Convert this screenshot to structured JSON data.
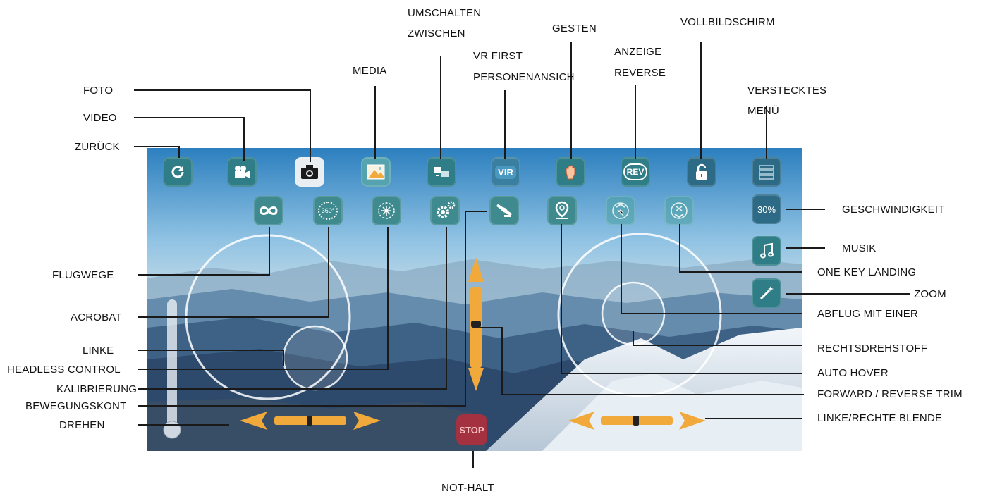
{
  "callouts": {
    "foto": "FOTO",
    "video": "VIDEO",
    "zurueck": "ZURÜCK",
    "media": "MEDIA",
    "umschalten_1": "UMSCHALTEN",
    "umschalten_2": "ZWISCHEN",
    "vr_1": "VR FIRST",
    "vr_2": "PERSONENANSICH",
    "gesten": "GESTEN",
    "anzeige_1": "ANZEIGE",
    "anzeige_2": "REVERSE",
    "vollbild": "VOLLBILDSCHIRM",
    "versteckt_1": "VERSTECKTES",
    "versteckt_2": "MENÜ",
    "geschwindigkeit": "GESCHWINDIGKEIT",
    "musik": "MUSIK",
    "one_key_landing": "ONE KEY LANDING",
    "zoom": "ZOOM",
    "abflug": "ABFLUG MIT EINER",
    "rechtsdrehstoff": "RECHTSDREHSTOFF",
    "auto_hover": "AUTO HOVER",
    "forward_reverse_trim": "FORWARD / REVERSE TRIM",
    "linke_rechte_blende": "LINKE/RECHTE BLENDE",
    "flugwege": "FLUGWEGE",
    "acrobat": "ACROBAT",
    "linke": "LINKE",
    "headless_control": "HEADLESS CONTROL",
    "kalibrierung": "KALIBRIERUNG",
    "bewegungskont": "BEWEGUNGSKONT",
    "drehen": "DREHEN",
    "not_halt": "NOT-HALT"
  },
  "screen": {
    "speed_label": "30%",
    "stop_label": "STOP",
    "rev_label": "REV",
    "vr_label": "VIR",
    "acrobat_label": "360°"
  },
  "colors": {
    "button_teal": "#2f7d86",
    "joystick_orange": "#f0a93a",
    "stop_red": "#c82832"
  }
}
